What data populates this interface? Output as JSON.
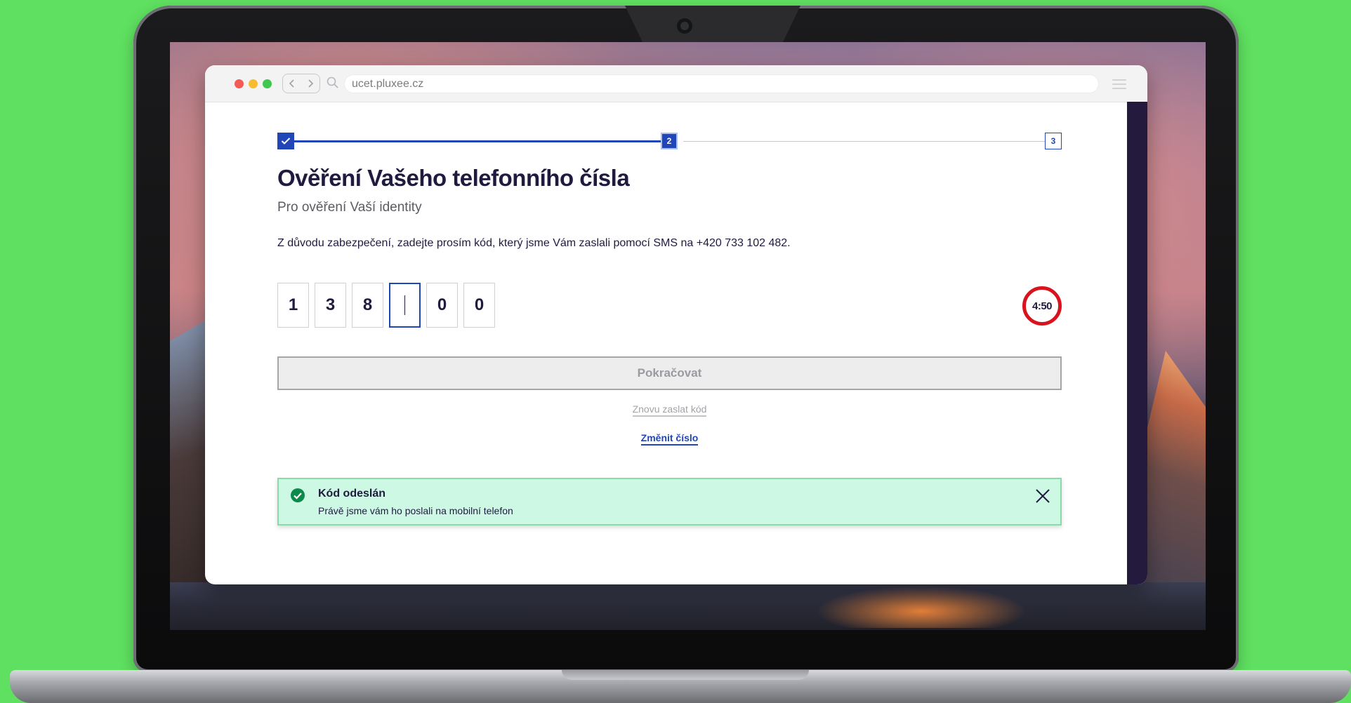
{
  "colors": {
    "background": "#5fe060",
    "primary": "#2146b8",
    "heading": "#1f1b3f",
    "timer_ring": "#d9131e",
    "success_bg": "#cdf8e3",
    "success_icon": "#0b8a4b"
  },
  "browser": {
    "url": "ucet.pluxee.cz",
    "back_icon": "chevron-left-icon",
    "forward_icon": "chevron-right-icon",
    "search_icon": "search-icon",
    "menu_icon": "menu-icon"
  },
  "stepper": {
    "step1_icon": "check-icon",
    "step2_label": "2",
    "step3_label": "3",
    "current_step": 2,
    "total_steps": 3
  },
  "page": {
    "title": "Ověření Vašeho telefonního čísla",
    "subtitle": "Pro ověření Vaší identity",
    "instruction": "Z důvodu zabezpečení, zadejte prosím kód, který jsme Vám zaslali pomocí SMS na +420 733 102 482."
  },
  "code": {
    "digits": [
      "1",
      "3",
      "8",
      "",
      "0",
      "0"
    ],
    "active_index": 3
  },
  "timer": {
    "value": "4:50"
  },
  "actions": {
    "continue_label": "Pokračovat",
    "resend_label": "Znovu zaslat kód",
    "change_number_label": "Změnit číslo"
  },
  "toast": {
    "title": "Kód odeslán",
    "message": "Právě jsme vám ho poslali na mobilní telefon",
    "icon": "check-circle-icon",
    "close_icon": "close-icon"
  }
}
